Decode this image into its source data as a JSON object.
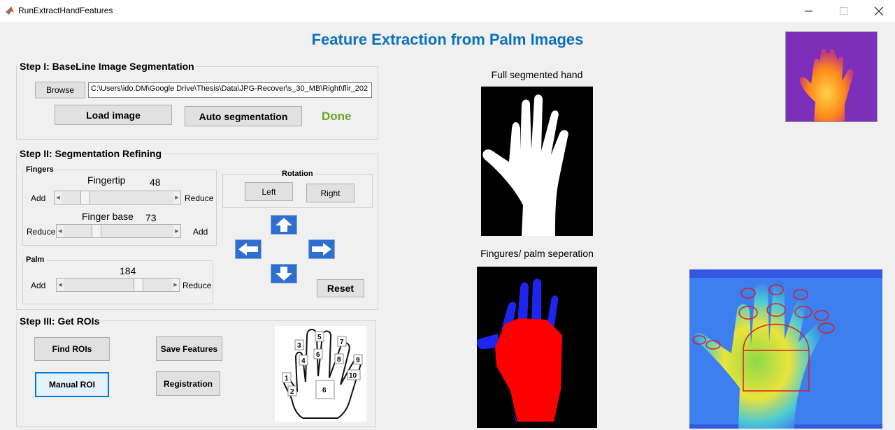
{
  "window": {
    "title": "RunExtractHandFeatures"
  },
  "header": {
    "title": "Feature Extraction from Palm Images"
  },
  "step1": {
    "title": "Step I: BaseLine Image Segmentation",
    "browse_label": "Browse",
    "path_value": "C:\\Users\\ido.DM\\Google Drive\\Thesis\\Data\\JPG-Recover\\s_30_MB\\Right\\flir_202",
    "load_label": "Load image",
    "auto_seg_label": "Auto segmentation",
    "status": "Done",
    "status_color": "#6aa52a"
  },
  "step2": {
    "title": "Step II: Segmentation Refining",
    "fingers": {
      "title": "Fingers",
      "fingertip": {
        "label": "Fingertip",
        "value": "48",
        "left": "Add",
        "right": "Reduce"
      },
      "fingerbase": {
        "label": "Finger base",
        "value": "73",
        "left": "Reduce",
        "right": "Add"
      }
    },
    "palm": {
      "title": "Palm",
      "value": "184",
      "left": "Add",
      "right": "Reduce"
    },
    "rotation": {
      "title": "Rotation",
      "left_label": "Left",
      "right_label": "Right"
    },
    "reset_label": "Reset"
  },
  "step3": {
    "title": "Step III: Get ROIs",
    "find_rois_label": "Find ROIs",
    "save_features_label": "Save Features",
    "manual_roi_label": "Manual ROI",
    "registration_label": "Registration",
    "roi_diagram_labels": [
      "1",
      "2",
      "3",
      "4",
      "5",
      "6",
      "7",
      "8",
      "9",
      "10",
      "6"
    ]
  },
  "images": {
    "full_segmented_caption": "Full segmented hand",
    "separation_caption": "Fingures/ palm seperation"
  }
}
